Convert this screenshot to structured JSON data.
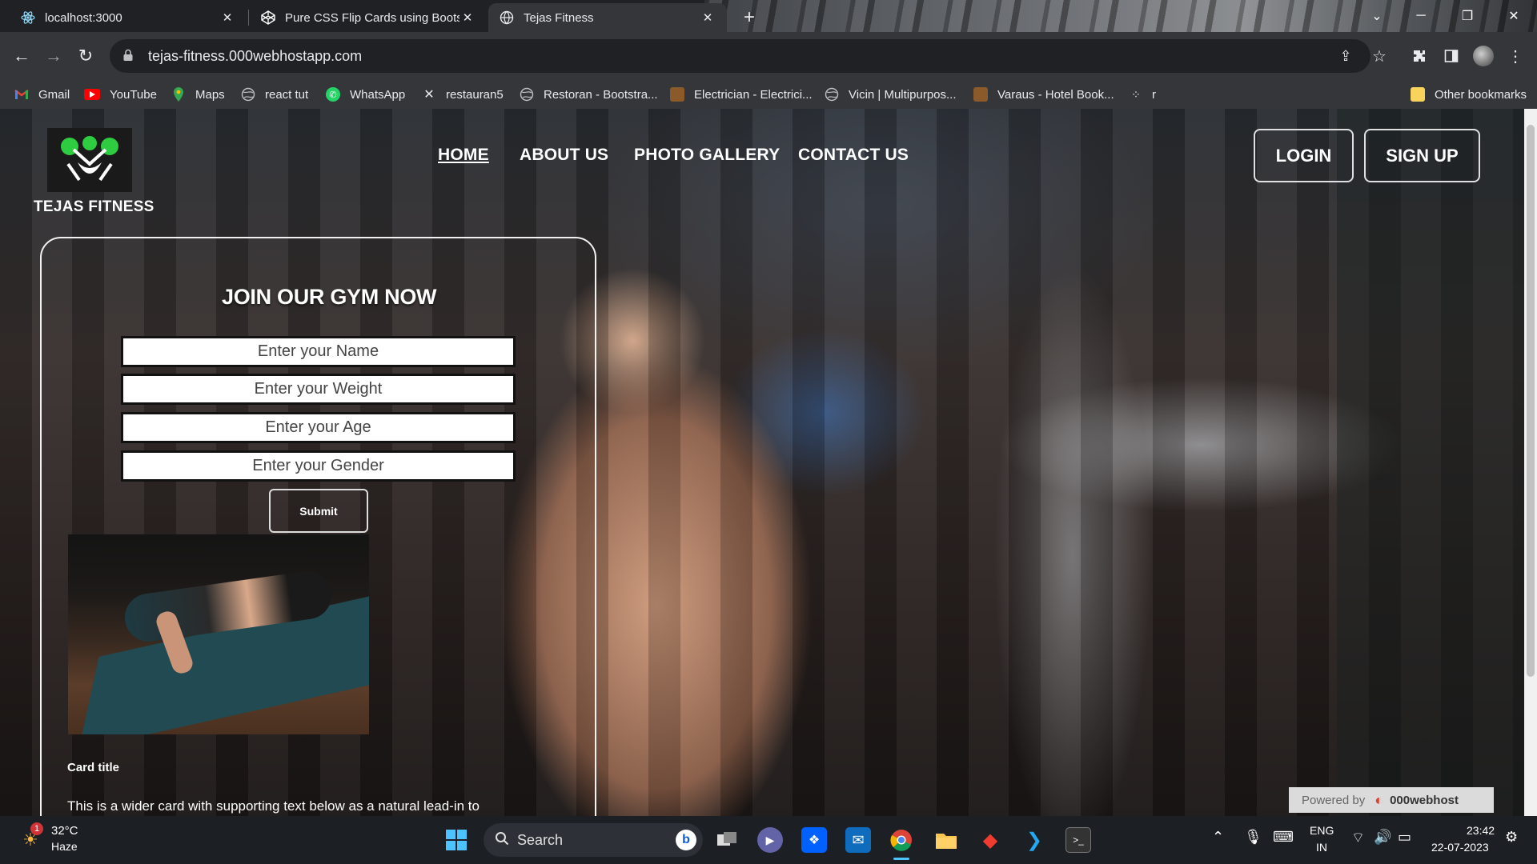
{
  "browser": {
    "tabs": [
      {
        "title": "localhost:3000",
        "icon": "react-icon",
        "active": false
      },
      {
        "title": "Pure CSS Flip Cards using Bootstr",
        "icon": "codepen-icon",
        "active": false
      },
      {
        "title": "Tejas Fitness",
        "icon": "globe-icon",
        "active": true
      }
    ],
    "url": "tejas-fitness.000webhostapp.com",
    "bookmarks": [
      {
        "label": "Gmail",
        "icon": "gmail-icon"
      },
      {
        "label": "YouTube",
        "icon": "youtube-icon"
      },
      {
        "label": "Maps",
        "icon": "maps-icon"
      },
      {
        "label": "react tut",
        "icon": "globe-icon"
      },
      {
        "label": "WhatsApp",
        "icon": "whatsapp-icon"
      },
      {
        "label": "restauran5",
        "icon": "tools-icon"
      },
      {
        "label": "Restoran - Bootstra...",
        "icon": "globe-icon"
      },
      {
        "label": "Electrician - Electrici...",
        "icon": "page-icon"
      },
      {
        "label": "Vicin | Multipurpos...",
        "icon": "globe-icon"
      },
      {
        "label": "Varaus - Hotel Book...",
        "icon": "page-icon"
      },
      {
        "label": "r",
        "icon": "dots-icon"
      }
    ],
    "other_bookmarks": "Other bookmarks"
  },
  "site": {
    "brand": "TEJAS FITNESS",
    "nav": [
      "HOME",
      "ABOUT US",
      "PHOTO GALLERY",
      "CONTACT US"
    ],
    "login": "LOGIN",
    "signup": "SIGN UP",
    "form": {
      "title": "JOIN OUR GYM NOW",
      "name_placeholder": "Enter your Name",
      "weight_placeholder": "Enter your Weight",
      "age_placeholder": "Enter your Age",
      "gender_placeholder": "Enter your Gender",
      "submit": "Submit"
    },
    "card": {
      "title": "Card title",
      "text": "This is a wider card with supporting text below as a natural lead-in to"
    },
    "powered_by": "Powered by",
    "host": "000webhost"
  },
  "taskbar": {
    "weather_temp": "32°C",
    "weather_desc": "Haze",
    "weather_badge": "1",
    "search": "Search",
    "lang": "ENG",
    "region": "IN",
    "time": "23:42",
    "date": "22-07-2023"
  }
}
